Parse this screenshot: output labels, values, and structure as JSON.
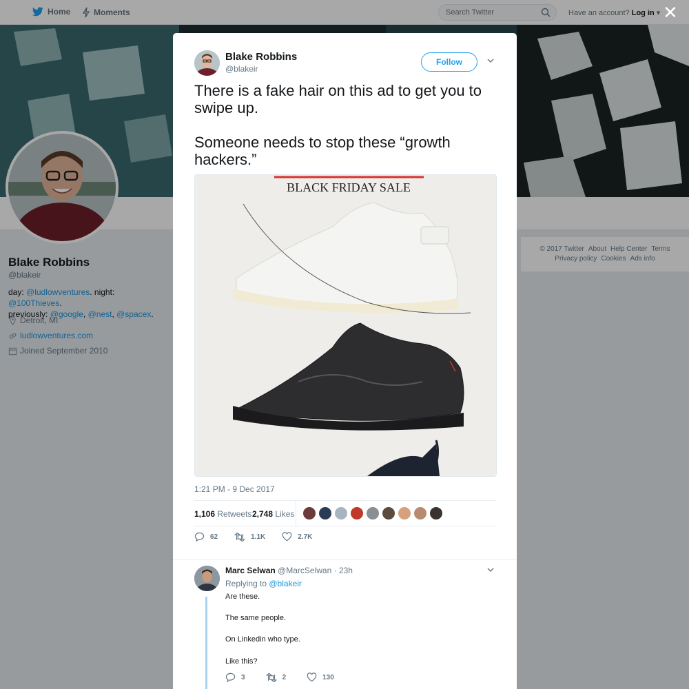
{
  "topbar": {
    "home_label": "Home",
    "moments_label": "Moments",
    "search_placeholder": "Search Twitter",
    "account_prompt": "Have an account?",
    "login_label": "Log in",
    "close_label": "✕"
  },
  "profile": {
    "name": "Blake Robbins",
    "handle": "@blakeir",
    "bio_day_prefix": "day: ",
    "bio_day_link": "@ludlowventures",
    "bio_night_prefix": ". night: ",
    "bio_night_link": "@100Thieves",
    "bio_night_suffix": ".",
    "bio_prev_prefix": "previously: ",
    "bio_prev_link1": "@google",
    "bio_comma1": ", ",
    "bio_prev_link2": "@nest",
    "bio_comma2": ", ",
    "bio_prev_link3": "@spacex",
    "bio_end": ".",
    "location": "Detroit, MI",
    "website": "ludlowventures.com",
    "joined": "Joined September 2010"
  },
  "footer": {
    "copyright": "© 2017 Twitter",
    "about": "About",
    "help": "Help Center",
    "terms": "Terms",
    "privacy": "Privacy policy",
    "cookies": "Cookies",
    "ads": "Ads info"
  },
  "tweet": {
    "author_name": "Blake Robbins",
    "author_handle": "@blakeir",
    "follow_label": "Follow",
    "text_line1": "There is a fake hair on this ad to get you to swipe up.",
    "text_line2": "Someone needs to stop these “growth hackers.”",
    "media_caption": "BLACK FRIDAY SALE",
    "timestamp": "1:21 PM - 9 Dec 2017",
    "retweets_count": "1,106",
    "retweets_label": "Retweets",
    "likes_count": "2,748",
    "likes_label": "Likes",
    "reply_count": "62",
    "retweet_action_count": "1.1K",
    "like_action_count": "2.7K",
    "liker_colors": [
      "#6b3a3a",
      "#2a3c55",
      "#a9b4c2",
      "#c0392b",
      "#8a8f94",
      "#5b4a3d",
      "#d9a07c",
      "#b98b6e",
      "#3a3330"
    ]
  },
  "reply": {
    "author_name": "Marc Selwan",
    "author_handle": "@MarcSelwan",
    "time": "· 23h",
    "replying_prefix": "Replying to ",
    "replying_to": "@blakeir",
    "line1": "Are these.",
    "line2": "The same people.",
    "line3": "On Linkedin who type.",
    "line4": "Like this?",
    "reply_count": "3",
    "retweet_count": "2",
    "like_count": "130"
  },
  "colors": {
    "accent": "#1da1f2",
    "link": "#1b95e0",
    "thread_line": "#a6d3f2"
  }
}
